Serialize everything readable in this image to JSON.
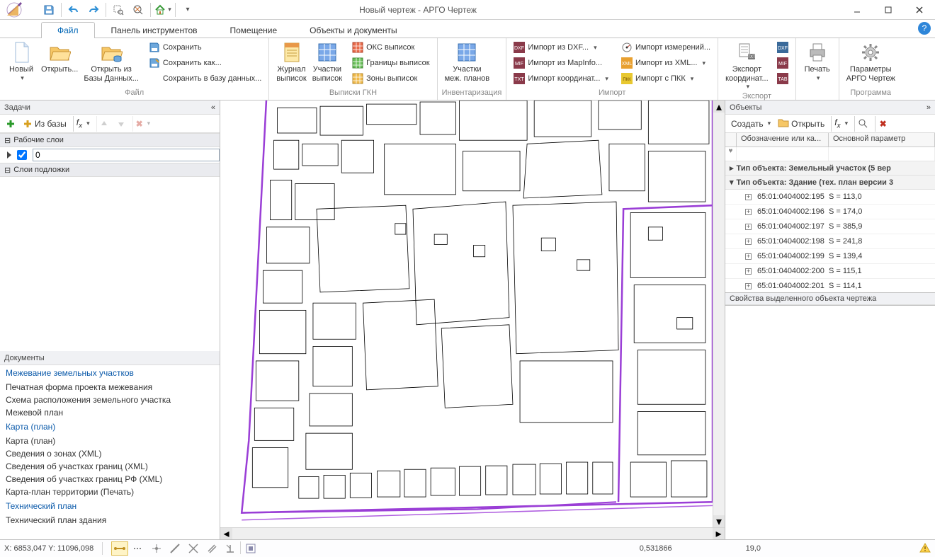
{
  "window": {
    "title": "Новый чертеж - АРГО Чертеж"
  },
  "tabs": [
    "Файл",
    "Панель инструментов",
    "Помещение",
    "Объекты и документы"
  ],
  "ribbon": {
    "file": {
      "new": "Новый",
      "open": "Открыть...",
      "open_db": "Открыть из\nБазы Данных...",
      "save": "Сохранить",
      "save_as": "Сохранить как...",
      "save_db": "Сохранить в базу данных...",
      "label": "Файл"
    },
    "gkn": {
      "journal": "Журнал\nвыписок",
      "parcels": "Участки\nвыписок",
      "oks": "ОКС выписок",
      "borders": "Границы выписок",
      "zones": "Зоны выписок",
      "label": "Выписки ГКН"
    },
    "inv": {
      "mez": "Участки\nмеж. планов",
      "label": "Инвентаризация"
    },
    "import": {
      "dxf": "Импорт из DXF...",
      "mapinfo": "Импорт из MapInfo...",
      "coords": "Импорт координат...",
      "meas": "Импорт измерений...",
      "xml": "Импорт из XML...",
      "pkk": "Импорт с ПКК",
      "label": "Импорт"
    },
    "export": {
      "coords": "Экспорт\nкоординат...",
      "label": "Экспорт"
    },
    "print": {
      "btn": "Печать",
      "label": ""
    },
    "prog": {
      "settings": "Параметры\nАРГО Чертеж",
      "label": "Программа"
    }
  },
  "left": {
    "tasks": "Задачи",
    "from_db": "Из базы",
    "section_layers": "Рабочие слои",
    "layer_value": "0",
    "section_base": "Слои подложки",
    "documents": "Документы",
    "groups": [
      {
        "head": "Межевание земельных участков",
        "items": [
          "Печатная форма проекта межевания",
          "Схема расположения земельного участка",
          "Межевой план"
        ]
      },
      {
        "head": "Карта (план)",
        "items": [
          "Карта (план)",
          "Сведения о зонах (XML)",
          "Сведения об участках границ (XML)",
          "Сведения об участках границ РФ (XML)",
          "Карта-план территории (Печать)"
        ]
      },
      {
        "head": "Технический план",
        "items": [
          "Технический план здания"
        ]
      }
    ]
  },
  "right": {
    "objects": "Объекты",
    "create": "Создать",
    "open": "Открыть",
    "col1": "Обозначение или ка...",
    "col2": "Основной параметр",
    "group1": "Тип объекта: Земельный участок (5 вер",
    "group2": "Тип объекта: Здание (тех. план версии 3",
    "rows": [
      {
        "id": "65:01:0404002:195",
        "p": "S = 113,0"
      },
      {
        "id": "65:01:0404002:196",
        "p": "S = 174,0"
      },
      {
        "id": "65:01:0404002:197",
        "p": "S = 385,9"
      },
      {
        "id": "65:01:0404002:198",
        "p": "S = 241,8"
      },
      {
        "id": "65:01:0404002:199",
        "p": "S = 139,4"
      },
      {
        "id": "65:01:0404002:200",
        "p": "S = 115,1"
      },
      {
        "id": "65:01:0404002:201",
        "p": "S = 114,1"
      }
    ],
    "props": "Свойства выделенного объекта чертежа"
  },
  "status": {
    "coords": "X: 6853,047 Y: 11096,098",
    "val1": "0,531866",
    "val2": "19,0"
  }
}
